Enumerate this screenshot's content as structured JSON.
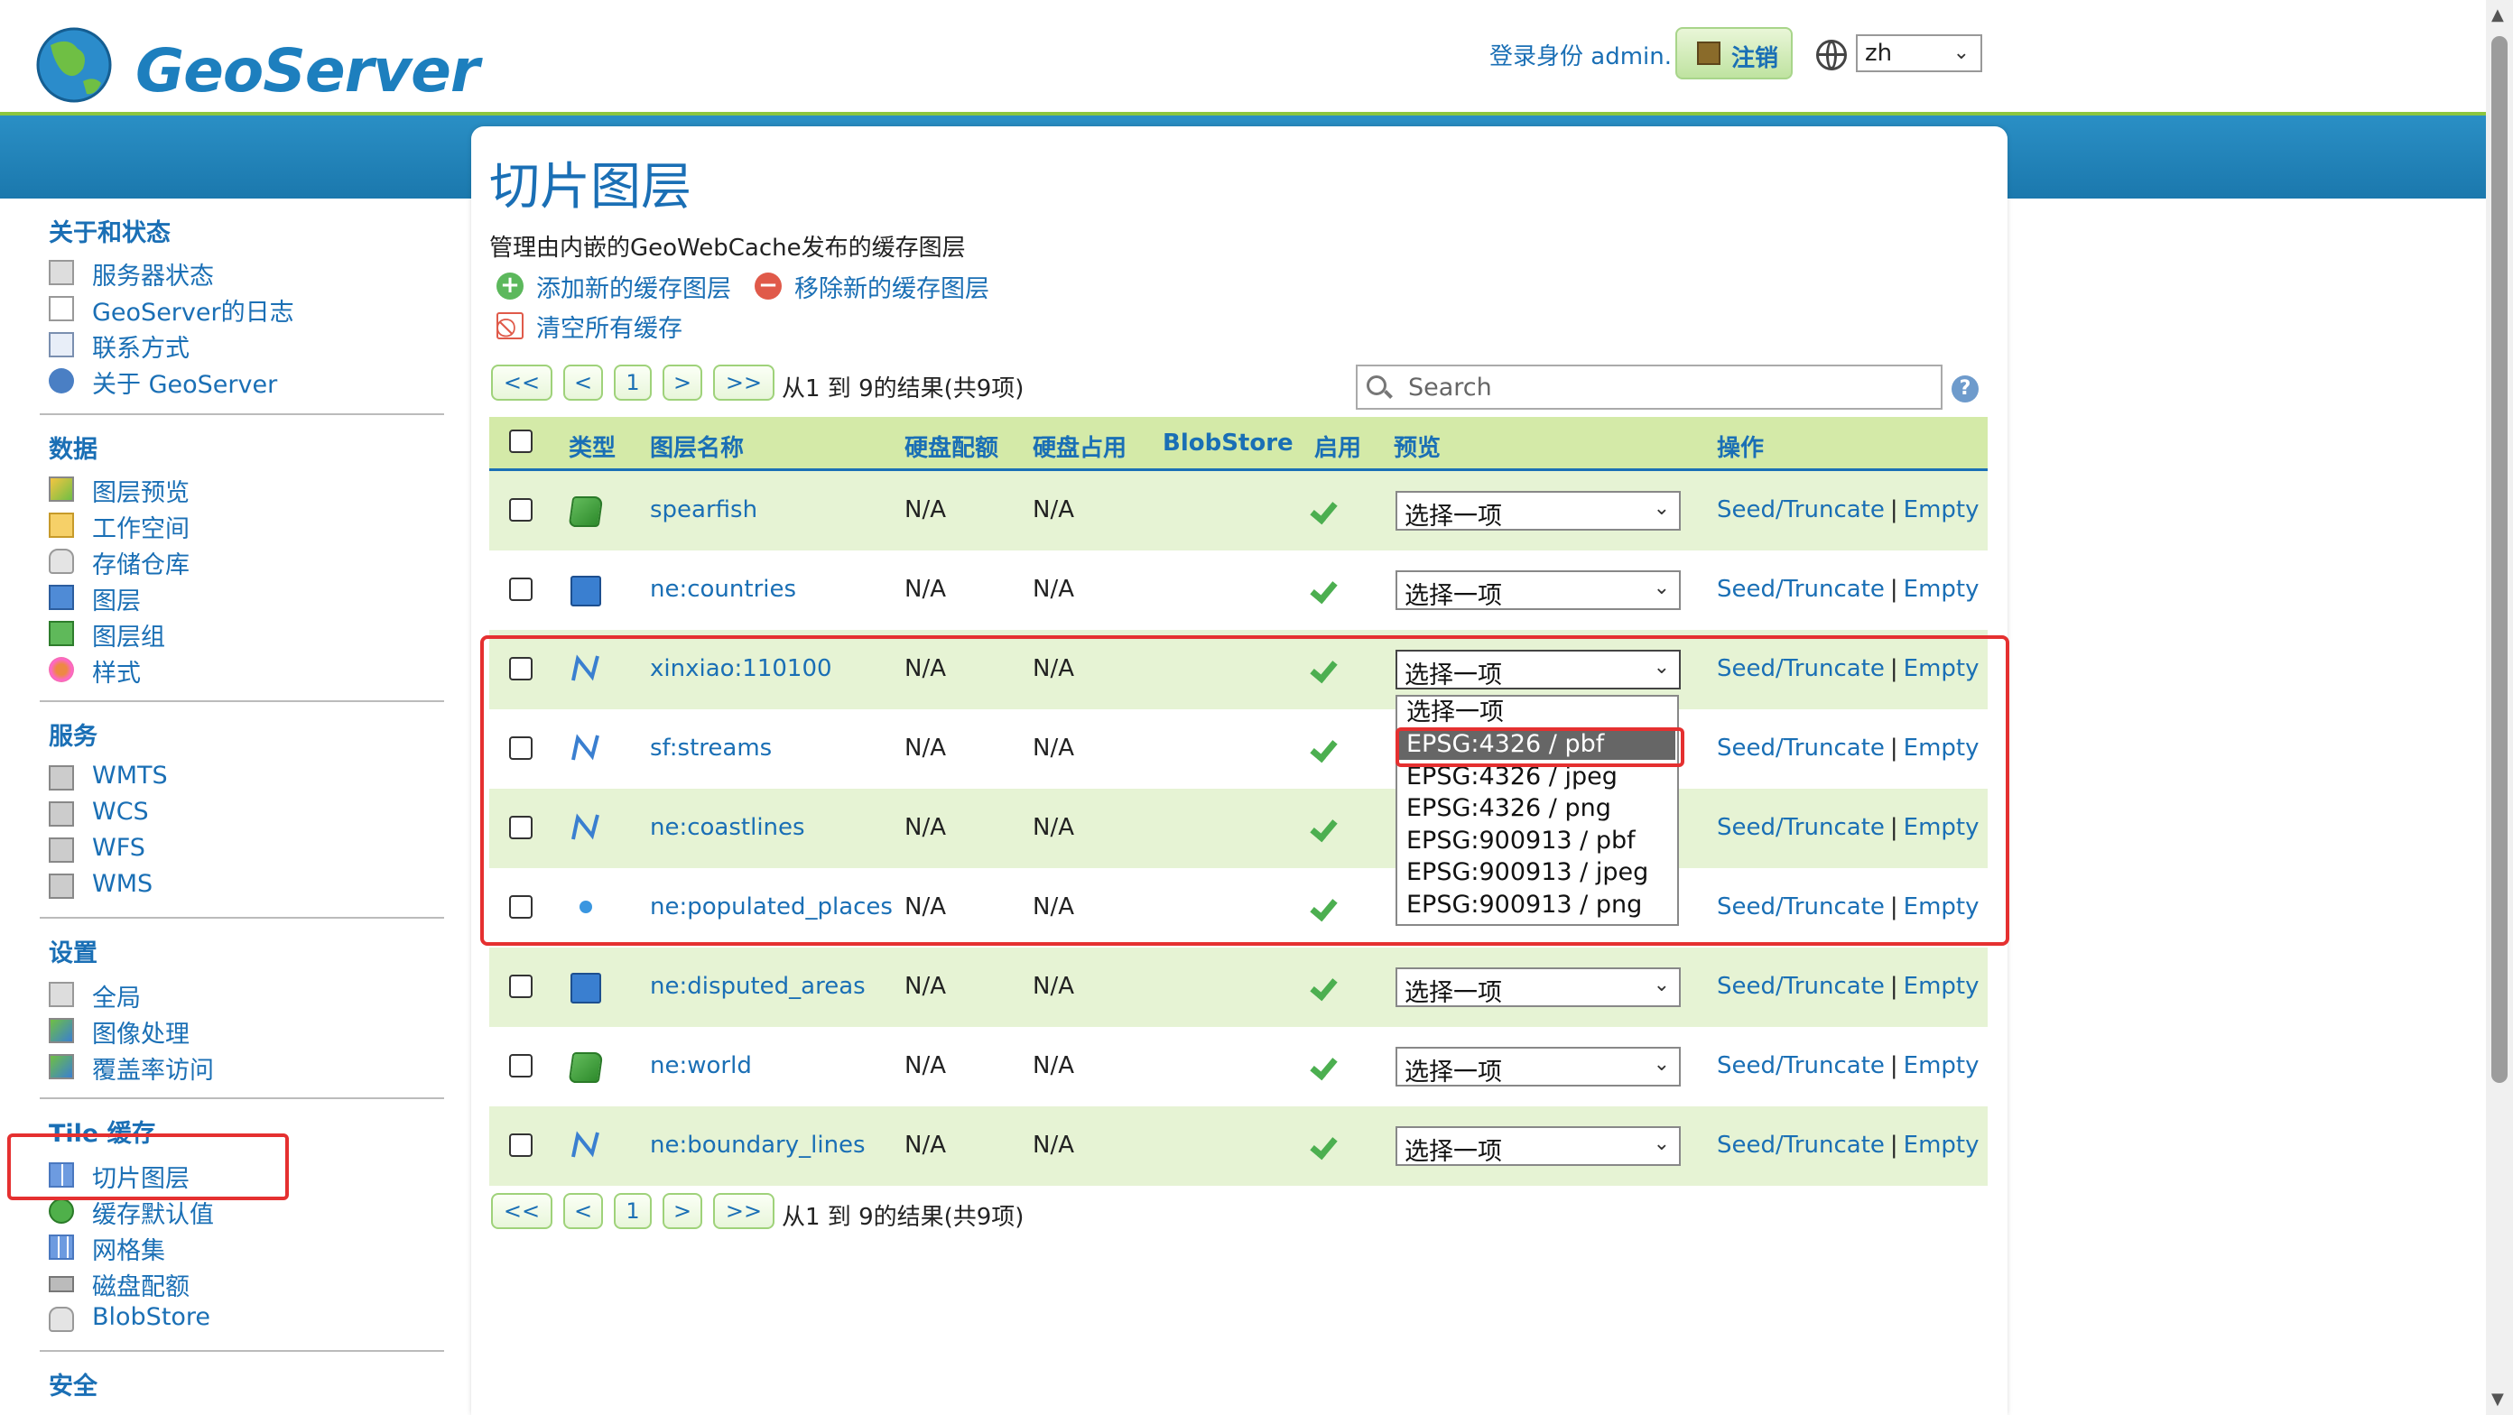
{
  "header": {
    "logo_text": "GeoServer",
    "login_text": "登录身份 admin.",
    "logout_label": "注销",
    "language": "zh"
  },
  "sidebar": {
    "sections": [
      {
        "title": "关于和状态",
        "items": [
          "服务器状态",
          "GeoServer的日志",
          "联系方式",
          "关于 GeoServer"
        ]
      },
      {
        "title": "数据",
        "items": [
          "图层预览",
          "工作空间",
          "存储仓库",
          "图层",
          "图层组",
          "样式"
        ]
      },
      {
        "title": "服务",
        "items": [
          "WMTS",
          "WCS",
          "WFS",
          "WMS"
        ]
      },
      {
        "title": "设置",
        "items": [
          "全局",
          "图像处理",
          "覆盖率访问"
        ]
      },
      {
        "title": "Tile 缓存",
        "items": [
          "切片图层",
          "缓存默认值",
          "网格集",
          "磁盘配额",
          "BlobStore"
        ]
      },
      {
        "title": "安全",
        "items": []
      }
    ]
  },
  "main": {
    "title": "切片图层",
    "description": "管理由内嵌的GeoWebCache发布的缓存图层",
    "actions": {
      "add": "添加新的缓存图层",
      "remove": "移除新的缓存图层",
      "clear": "清空所有缓存"
    },
    "pager": {
      "first": "<<",
      "prev": "<",
      "page": "1",
      "next": ">",
      "last": ">>",
      "info": "从1 到 9的结果(共9项)"
    },
    "search_placeholder": "Search",
    "columns": [
      "类型",
      "图层名称",
      "硬盘配额",
      "硬盘占用",
      "BlobStore",
      "启用",
      "预览",
      "操作"
    ],
    "rows": [
      {
        "type": "polygon",
        "name": "spearfish",
        "quota": "N/A",
        "usage": "N/A",
        "preview": "选择一项",
        "seed": "Seed/Truncate",
        "empty": "Empty"
      },
      {
        "type": "polygon-blue",
        "name": "ne:countries",
        "quota": "N/A",
        "usage": "N/A",
        "preview": "选择一项",
        "seed": "Seed/Truncate",
        "empty": "Empty"
      },
      {
        "type": "line",
        "name": "xinxiao:110100",
        "quota": "N/A",
        "usage": "N/A",
        "preview": "选择一项",
        "seed": "Seed/Truncate",
        "empty": "Empty"
      },
      {
        "type": "line",
        "name": "sf:streams",
        "quota": "N/A",
        "usage": "N/A",
        "preview": "",
        "seed": "Seed/Truncate",
        "empty": "Empty"
      },
      {
        "type": "line",
        "name": "ne:coastlines",
        "quota": "N/A",
        "usage": "N/A",
        "preview": "",
        "seed": "Seed/Truncate",
        "empty": "Empty"
      },
      {
        "type": "point",
        "name": "ne:populated_places",
        "quota": "N/A",
        "usage": "N/A",
        "preview": "",
        "seed": "Seed/Truncate",
        "empty": "Empty"
      },
      {
        "type": "polygon-blue",
        "name": "ne:disputed_areas",
        "quota": "N/A",
        "usage": "N/A",
        "preview": "选择一项",
        "seed": "Seed/Truncate",
        "empty": "Empty"
      },
      {
        "type": "polygon",
        "name": "ne:world",
        "quota": "N/A",
        "usage": "N/A",
        "preview": "选择一项",
        "seed": "Seed/Truncate",
        "empty": "Empty"
      },
      {
        "type": "line",
        "name": "ne:boundary_lines",
        "quota": "N/A",
        "usage": "N/A",
        "preview": "选择一项",
        "seed": "Seed/Truncate",
        "empty": "Empty"
      }
    ],
    "dropdown_options": [
      "选择一项",
      "EPSG:4326 / pbf",
      "EPSG:4326 / jpeg",
      "EPSG:4326 / png",
      "EPSG:900913 / pbf",
      "EPSG:900913 / jpeg",
      "EPSG:900913 / png"
    ],
    "dropdown_highlighted": "EPSG:4326 / pbf"
  },
  "colors": {
    "brand_blue": "#1a6fb5",
    "header_green": "#d4eaa8",
    "row_alt": "#e6f3d4",
    "annotation_red": "#e53030"
  }
}
